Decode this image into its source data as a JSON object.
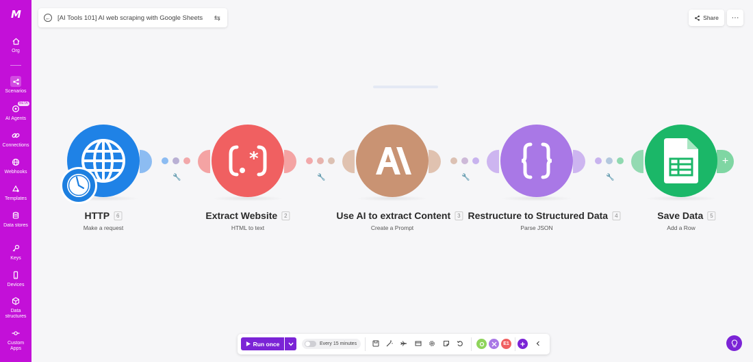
{
  "app": {
    "logo": "M",
    "colors": {
      "sidebar": "#c310d8",
      "accent": "#7b24d6"
    }
  },
  "sidebar": {
    "items": [
      {
        "label": "Org",
        "icon": "home-icon"
      },
      {
        "label": "Scenarios",
        "icon": "share-nodes-icon"
      },
      {
        "label": "AI Agents",
        "icon": "ai-agent-icon",
        "badge": "BETA"
      },
      {
        "label": "Connections",
        "icon": "link-icon"
      },
      {
        "label": "Webhooks",
        "icon": "globe-icon"
      },
      {
        "label": "Templates",
        "icon": "templates-icon"
      },
      {
        "label": "Data stores",
        "icon": "database-icon"
      },
      {
        "label": "Keys",
        "icon": "key-icon"
      },
      {
        "label": "Devices",
        "icon": "phone-icon"
      },
      {
        "label": "Data structures",
        "icon": "cube-icon"
      },
      {
        "label": "Custom Apps",
        "icon": "custom-app-icon"
      }
    ]
  },
  "header": {
    "title": "[AI Tools 101] AI web scraping with Google Sheets",
    "share_label": "Share",
    "more_label": "···"
  },
  "modules": [
    {
      "name": "HTTP",
      "number": "6",
      "subtitle": "Make a request",
      "color": "#1f82e6",
      "icon": "globe-icon"
    },
    {
      "name": "Extract Website",
      "number": "2",
      "subtitle": "HTML to text",
      "color": "#f06061",
      "icon": "regex-icon"
    },
    {
      "name": "Use AI to extract Content",
      "number": "3",
      "subtitle": "Create a Prompt",
      "color": "#c99373",
      "icon": "anthropic-icon"
    },
    {
      "name": "Restructure to Structured Data",
      "number": "4",
      "subtitle": "Parse JSON",
      "color": "#a978e6",
      "icon": "json-braces-icon"
    },
    {
      "name": "Save Data",
      "number": "5",
      "subtitle": "Add a Row",
      "color": "#1bb768",
      "icon": "google-sheets-icon"
    }
  ],
  "toolbar": {
    "run_label": "Run once",
    "schedule_label": "Every 15 minutes",
    "schedule_enabled": false,
    "badge_label": "E1"
  }
}
